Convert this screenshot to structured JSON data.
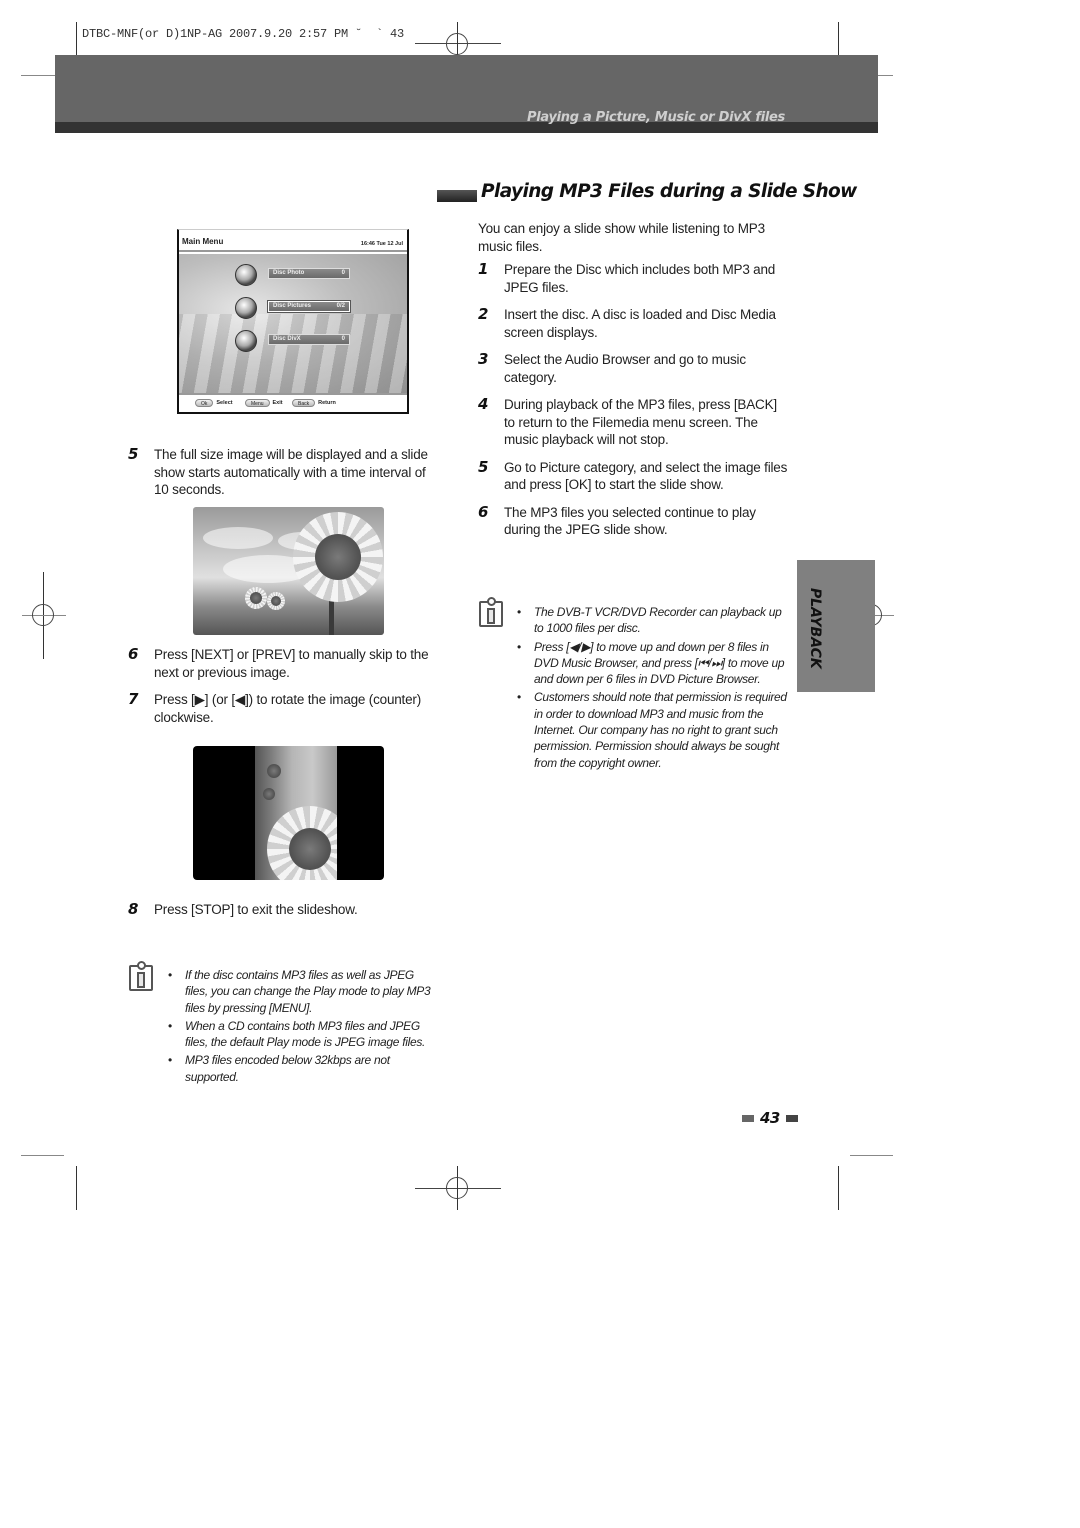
{
  "print_slug": "DTBC-MNF(or D)1NP-AG 2007.9.20 2:57 PM ˘  ` 43",
  "header": {
    "chapter_title": "Playing a Picture, Music or DivX files"
  },
  "section": {
    "title": "Playing MP3 Files during a Slide Show",
    "intro": "You can enjoy a slide show while listening to MP3 music files.",
    "steps": [
      {
        "num": "1",
        "text": "Prepare the Disc which includes both MP3 and JPEG files."
      },
      {
        "num": "2",
        "text": "Insert the disc. A disc is loaded and Disc Media screen displays."
      },
      {
        "num": "3",
        "text": "Select the Audio Browser and go to music category."
      },
      {
        "num": "4",
        "text": "During playback of the MP3 files, press [BACK] to return to the Filemedia menu screen. The music playback will not stop."
      },
      {
        "num": "5",
        "text": "Go to Picture category, and select the image files and press [OK] to start the slide show."
      },
      {
        "num": "6",
        "text": "The MP3 files you selected continue to play during the JPEG slide show."
      }
    ],
    "notes": [
      "The DVB-T VCR/DVD Recorder can playback up to 1000 files per disc.",
      "Press [◀/▶] to move up and down per 8 files in DVD Music Browser, and press [⏮/⏭] to move up and down per 6 files in DVD Picture Browser.",
      "Customers should note that permission is required in order to download MP3  and music from the Internet. Our company has no right to grant such permission. Permission should always be sought from the copyright owner."
    ]
  },
  "left_column": {
    "menu_screen": {
      "title": "Main Menu",
      "clock": "16:46 Tue 12 Jul",
      "items": [
        {
          "label": "Disc Photo",
          "count": "0",
          "icon": "photo-disc-icon"
        },
        {
          "label": "Disc Pictures",
          "count": "0/2",
          "icon": "picture-disc-icon",
          "selected": true
        },
        {
          "label": "Disc DivX",
          "count": "0",
          "icon": "divx-disc-icon"
        }
      ],
      "footer_keys": [
        {
          "key": "Ok",
          "label": "Select"
        },
        {
          "key": "Menu",
          "label": "Exit"
        },
        {
          "key": "Back",
          "label": "Return"
        }
      ]
    },
    "steps": [
      {
        "num": "5",
        "text": "The full size image will be displayed and a slide show starts automatically with a time interval of 10 seconds."
      },
      {
        "num": "6",
        "text": "Press [NEXT] or [PREV] to manually skip to the next or previous image."
      },
      {
        "num": "7",
        "text": "Press [▶] (or [◀]) to rotate the image (counter) clockwise."
      },
      {
        "num": "8",
        "text": "Press [STOP] to exit the slideshow."
      }
    ],
    "notes": [
      "If the disc contains MP3 files as well as JPEG files, you can change the Play mode to play MP3 files by pressing [MENU].",
      "When a CD contains both MP3 files and JPEG files, the default Play mode is JPEG image files.",
      "MP3 files encoded below 32kbps are not supported."
    ]
  },
  "side_tab": {
    "label": "PLAYBACK"
  },
  "page_number": "43"
}
